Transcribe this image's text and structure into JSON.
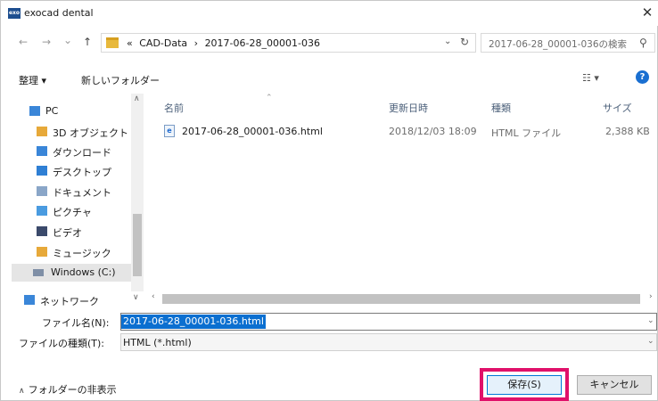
{
  "window": {
    "title": "exocad dental",
    "logo_text": "exo",
    "close_glyph": "✕"
  },
  "nav_buttons": {
    "back": "←",
    "forward": "→",
    "history": "⌄",
    "up": "↑"
  },
  "address": {
    "overflow": "«",
    "crumbs": [
      "CAD-Data",
      "›",
      "2017-06-28_00001-036"
    ],
    "dropdown_glyph": "⌄",
    "refresh_glyph": "↻"
  },
  "search": {
    "placeholder": "2017-06-28_00001-036の検索",
    "icon": "search-icon"
  },
  "toolbar": {
    "organize": "整理 ▾",
    "new_folder": "新しいフォルダー",
    "view_glyph": "☷ ▾",
    "help_glyph": "?"
  },
  "sidebar": {
    "items": [
      {
        "label": "PC",
        "icon": "pc-icon",
        "color": "#3a86d8"
      },
      {
        "label": "3D オブジェクト",
        "icon": "3d-objects-icon",
        "color": "#e7a93a"
      },
      {
        "label": "ダウンロード",
        "icon": "downloads-icon",
        "color": "#3a86d8"
      },
      {
        "label": "デスクトップ",
        "icon": "desktop-icon",
        "color": "#2f7fd4"
      },
      {
        "label": "ドキュメント",
        "icon": "documents-icon",
        "color": "#8aa6c8"
      },
      {
        "label": "ピクチャ",
        "icon": "pictures-icon",
        "color": "#4a9be0"
      },
      {
        "label": "ビデオ",
        "icon": "videos-icon",
        "color": "#3b4a6b"
      },
      {
        "label": "ミュージック",
        "icon": "music-icon",
        "color": "#e7a93a"
      },
      {
        "label": "Windows (C:)",
        "icon": "drive-icon",
        "color": "#7f8fa6"
      },
      {
        "label": "ネットワーク",
        "icon": "network-icon",
        "color": "#3a86d8"
      }
    ]
  },
  "columns": {
    "name": "名前",
    "modified": "更新日時",
    "type": "種類",
    "size": "サイズ"
  },
  "files": [
    {
      "name": "2017-06-28_00001-036.html",
      "modified": "2018/12/03 18:09",
      "type": "HTML ファイル",
      "size": "2,388 KB",
      "icon_glyph": "e"
    }
  ],
  "fields": {
    "filename_label": "ファイル名(N):",
    "filename_value": "2017-06-28_00001-036.html",
    "filetype_label": "ファイルの種類(T):",
    "filetype_value": "HTML (*.html)"
  },
  "footer": {
    "hide_folders": "フォルダーの非表示",
    "hide_glyph": "∧",
    "save": "保存(S)",
    "cancel": "キャンセル"
  },
  "colors": {
    "highlight": "#e0116a",
    "selection": "#0b6fd0",
    "help": "#1a6fd1"
  }
}
